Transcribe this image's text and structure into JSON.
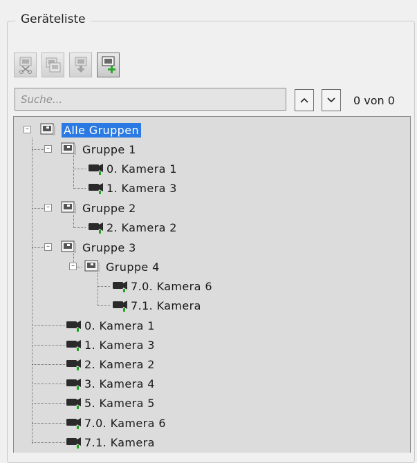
{
  "panel": {
    "title": "Geräteliste"
  },
  "toolbar": {
    "buttons": [
      {
        "icon": "cut-icon",
        "enabled": false
      },
      {
        "icon": "copy-icon",
        "enabled": false
      },
      {
        "icon": "paste-icon",
        "enabled": false
      },
      {
        "icon": "add-group-icon",
        "enabled": true
      }
    ]
  },
  "search": {
    "placeholder": "Suche...",
    "value": "",
    "count": "0 von 0"
  },
  "tree": {
    "root": "Alle Gruppen",
    "group1": {
      "label": "Gruppe 1",
      "items": [
        "0. Kamera 1",
        "1. Kamera 3"
      ]
    },
    "group2": {
      "label": "Gruppe 2",
      "items": [
        "2. Kamera 2"
      ]
    },
    "group3": {
      "label": "Gruppe 3"
    },
    "group4": {
      "label": "Gruppe 4",
      "items": [
        "7.0. Kamera 6",
        "7.1. Kamera"
      ]
    },
    "cameras": [
      "0. Kamera 1",
      "1. Kamera 3",
      "2. Kamera 2",
      "3. Kamera 4",
      "5. Kamera 5",
      "7.0. Kamera 6",
      "7.1. Kamera"
    ]
  },
  "colors": {
    "selection": "#2b79e2",
    "camera_status": "#1ea51e",
    "add_accent": "#2ea52e"
  }
}
